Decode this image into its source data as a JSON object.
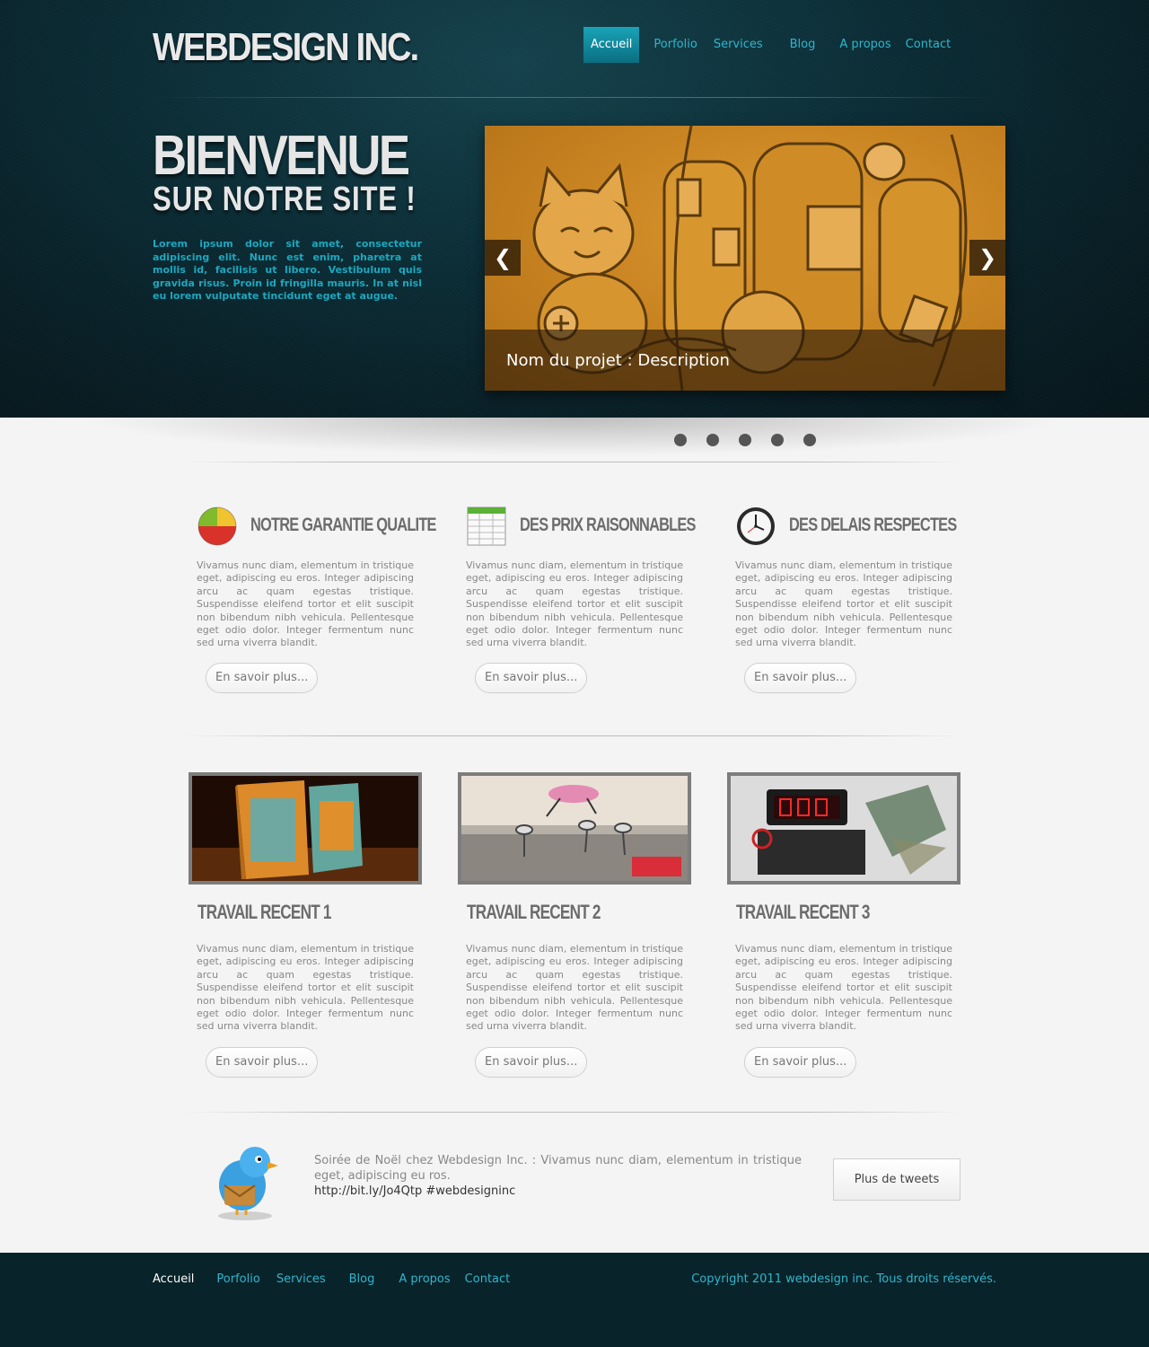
{
  "brand": {
    "logo": "WEBDESIGN INC."
  },
  "nav": {
    "items": [
      {
        "label": "Accueil",
        "active": true
      },
      {
        "label": "Porfolio"
      },
      {
        "label": "Services"
      },
      {
        "label": "Blog"
      },
      {
        "label": "A propos"
      },
      {
        "label": "Contact"
      }
    ]
  },
  "hero": {
    "title_line1": "BIENVENUE",
    "title_line2": "SUR NOTRE SITE !",
    "text": "Lorem ipsum dolor sit amet, consectetur adipiscing elit. Nunc est enim, pharetra at mollis id, facilisis ut libero. Vestibulum quis gravida risus. Proin id fringilla mauris. In at nisl eu lorem vulputate tincidunt eget at augue."
  },
  "slider": {
    "caption": "Nom du projet : Description",
    "prev_icon": "❮",
    "next_icon": "❯",
    "dot_count": 5
  },
  "features": [
    {
      "title": "NOTRE GARANTIE QUALITE",
      "icon": "pie-chart-icon",
      "text": "Vivamus nunc diam, elementum in tristique eget, adipiscing eu eros. Integer adipiscing arcu ac quam egestas tristique. Suspendisse eleifend tortor et elit suscipit non bibendum nibh vehicula. Pellentesque eget odio dolor. Integer fermentum nunc sed urna viverra blandit.",
      "button": "En savoir plus..."
    },
    {
      "title": "DES PRIX RAISONNABLES",
      "icon": "spreadsheet-icon",
      "text": "Vivamus nunc diam, elementum in tristique eget, adipiscing eu eros. Integer adipiscing arcu ac quam egestas tristique. Suspendisse eleifend tortor et elit suscipit non bibendum nibh vehicula. Pellentesque eget odio dolor. Integer fermentum nunc sed urna viverra blandit.",
      "button": "En savoir plus..."
    },
    {
      "title": "DES DELAIS RESPECTES",
      "icon": "clock-icon",
      "text": "Vivamus nunc diam, elementum in tristique eget, adipiscing eu eros. Integer adipiscing arcu ac quam egestas tristique. Suspendisse eleifend tortor et elit suscipit non bibendum nibh vehicula. Pellentesque eget odio dolor. Integer fermentum nunc sed urna viverra blandit.",
      "button": "En savoir plus..."
    }
  ],
  "works": [
    {
      "title": "TRAVAIL RECENT 1",
      "text": "Vivamus nunc diam, elementum in tristique eget, adipiscing eu eros. Integer adipiscing arcu ac quam egestas tristique. Suspendisse eleifend tortor et elit suscipit non bibendum nibh vehicula. Pellentesque eget odio dolor. Integer fermentum nunc sed urna viverra blandit.",
      "button": "En savoir plus..."
    },
    {
      "title": "TRAVAIL RECENT 2",
      "text": "Vivamus nunc diam, elementum in tristique eget, adipiscing eu eros. Integer adipiscing arcu ac quam egestas tristique. Suspendisse eleifend tortor et elit suscipit non bibendum nibh vehicula. Pellentesque eget odio dolor. Integer fermentum nunc sed urna viverra blandit.",
      "button": "En savoir plus..."
    },
    {
      "title": "TRAVAIL RECENT 3",
      "text": "Vivamus nunc diam, elementum in tristique eget, adipiscing eu eros. Integer adipiscing arcu ac quam egestas tristique. Suspendisse eleifend tortor et elit suscipit non bibendum nibh vehicula. Pellentesque eget odio dolor. Integer fermentum nunc sed urna viverra blandit.",
      "button": "En savoir plus..."
    }
  ],
  "twitter": {
    "icon": "twitter-bird-icon",
    "tweet": "Soirée de Noël chez Webdesign Inc. : Vivamus nunc diam, elementum in tristique eget, adipiscing eu ros.",
    "link": "http://bit.ly/Jo4Qtp #webdesigninc",
    "button": "Plus de tweets"
  },
  "footer": {
    "items": [
      {
        "label": "Accueil",
        "active": true
      },
      {
        "label": "Porfolio"
      },
      {
        "label": "Services"
      },
      {
        "label": "Blog"
      },
      {
        "label": "A propos"
      },
      {
        "label": "Contact"
      }
    ],
    "copyright": "Copyright 2011 webdesign inc. Tous droits réservés."
  },
  "colors": {
    "header_bg": "#0b2d36",
    "accent": "#2fb6cc",
    "slider_bg": "#c98422",
    "footer_bg": "#08232a"
  }
}
